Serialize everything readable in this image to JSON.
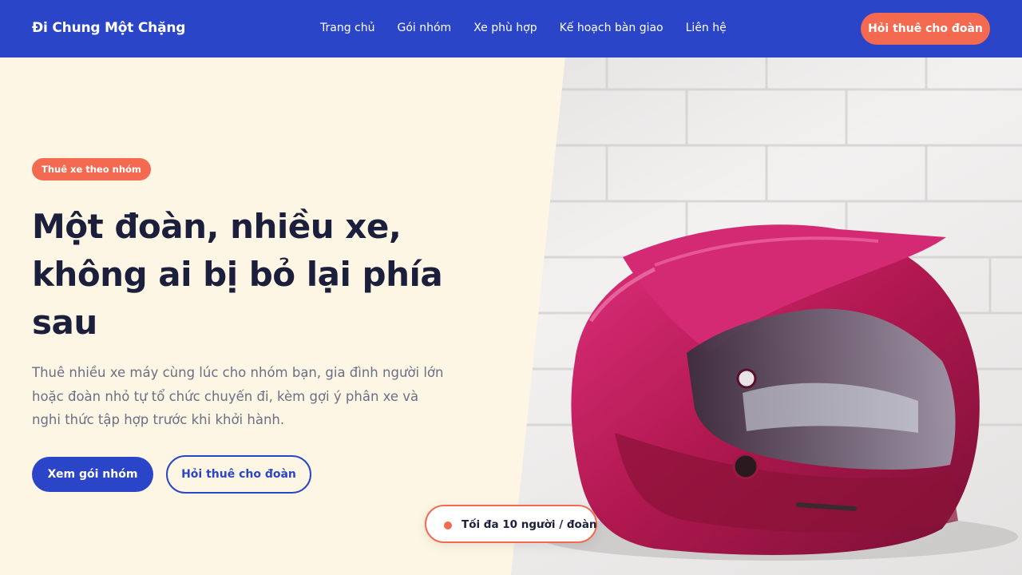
{
  "nav": {
    "brand": "Đi Chung Một Chặng",
    "links": [
      "Trang chủ",
      "Gói nhóm",
      "Xe phù hợp",
      "Kế hoạch bàn giao",
      "Liên hệ"
    ],
    "cta": "Hỏi thuê cho đoàn"
  },
  "hero": {
    "badge": "Thuê xe theo nhóm",
    "headline_line1": "Một đoàn, nhiều xe,",
    "headline_line2": "không ai bị bỏ lại phía",
    "headline_line3": "sau",
    "description": "Thuê nhiều xe máy cùng lúc cho nhóm bạn, gia đình người lớn hoặc đoàn nhỏ tự tổ chức chuyến đi, kèm gợi ý phân xe và nghi thức tập hợp trước khi khởi hành.",
    "primary_button": "Xem gói nhóm",
    "secondary_button": "Hỏi thuê cho đoàn",
    "capacity": "Tối đa 10 người / đoàn"
  },
  "colors": {
    "brand_blue": "#2b45c8",
    "accent_coral": "#f36a50",
    "cream_bg": "#fef6e4",
    "heading_navy": "#1b1f3b",
    "helmet_magenta": "#c8206a"
  }
}
